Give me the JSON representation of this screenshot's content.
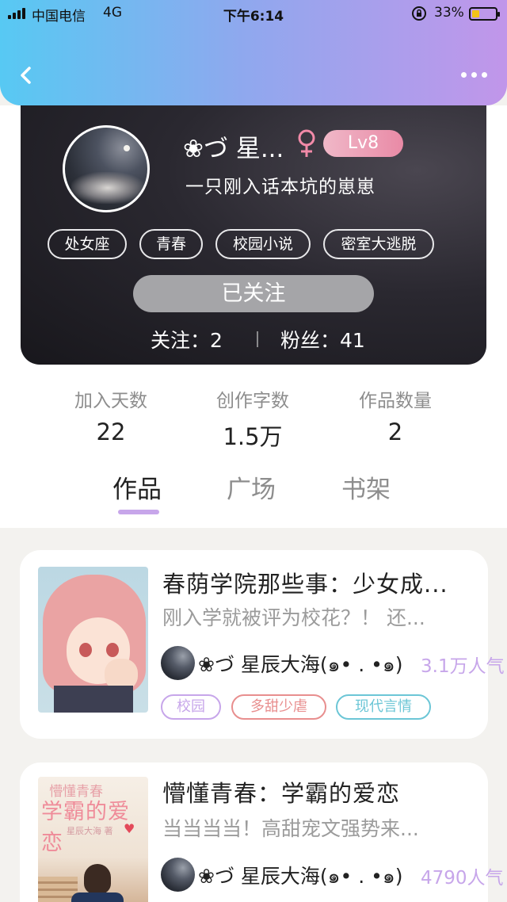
{
  "status_bar": {
    "carrier": "中国电信",
    "network": "4G",
    "time": "下午6:14",
    "battery_percent": "33%",
    "battery_level": 0.33
  },
  "header": {
    "back_icon": "chevron-left-icon",
    "more_icon": "more-dots-icon"
  },
  "profile": {
    "nickname": "❀づ 星...",
    "gender_icon": "female-icon",
    "level": "Lv8",
    "bio": "一只刚入话本坑的崽崽",
    "tags": [
      "处女座",
      "青春",
      "校园小说",
      "密室大逃脱"
    ],
    "follow_button": "已关注",
    "following_label": "关注：2",
    "fans_label": "粉丝：41"
  },
  "stats": [
    {
      "label": "加入天数",
      "value": "22"
    },
    {
      "label": "创作字数",
      "value": "1.5万"
    },
    {
      "label": "作品数量",
      "value": "2"
    }
  ],
  "tabs": [
    "作品",
    "广场",
    "书架"
  ],
  "active_tab": "作品",
  "works": [
    {
      "title": "春荫学院那些事：少女成...",
      "desc": "刚入学就被评为校花？！ 还...",
      "author": "❀づ 星辰大海(๑• . •๑)",
      "popularity": "3.1万人气",
      "tags": [
        {
          "label": "校园",
          "color": "#c7a6ea"
        },
        {
          "label": "多甜少虐",
          "color": "#e88e8e"
        },
        {
          "label": "现代言情",
          "color": "#6cc6d6"
        }
      ]
    },
    {
      "title": "懵懂青春：学霸的爱恋",
      "desc": "当当当当！高甜宠文强势来...",
      "author": "❀づ 星辰大海(๑• . •๑)",
      "popularity": "4790人气",
      "cover_text": {
        "line1": "懵懂青春",
        "line2": "学霸的爱恋",
        "line3": "星辰大海 著"
      }
    }
  ],
  "colors": {
    "header_gradient_start": "#57c9f3",
    "header_gradient_end": "#c196ea",
    "accent": "#c7a6ea",
    "level_badge": "#e98aa6",
    "follow_button_bg": "#a5a5a8"
  }
}
